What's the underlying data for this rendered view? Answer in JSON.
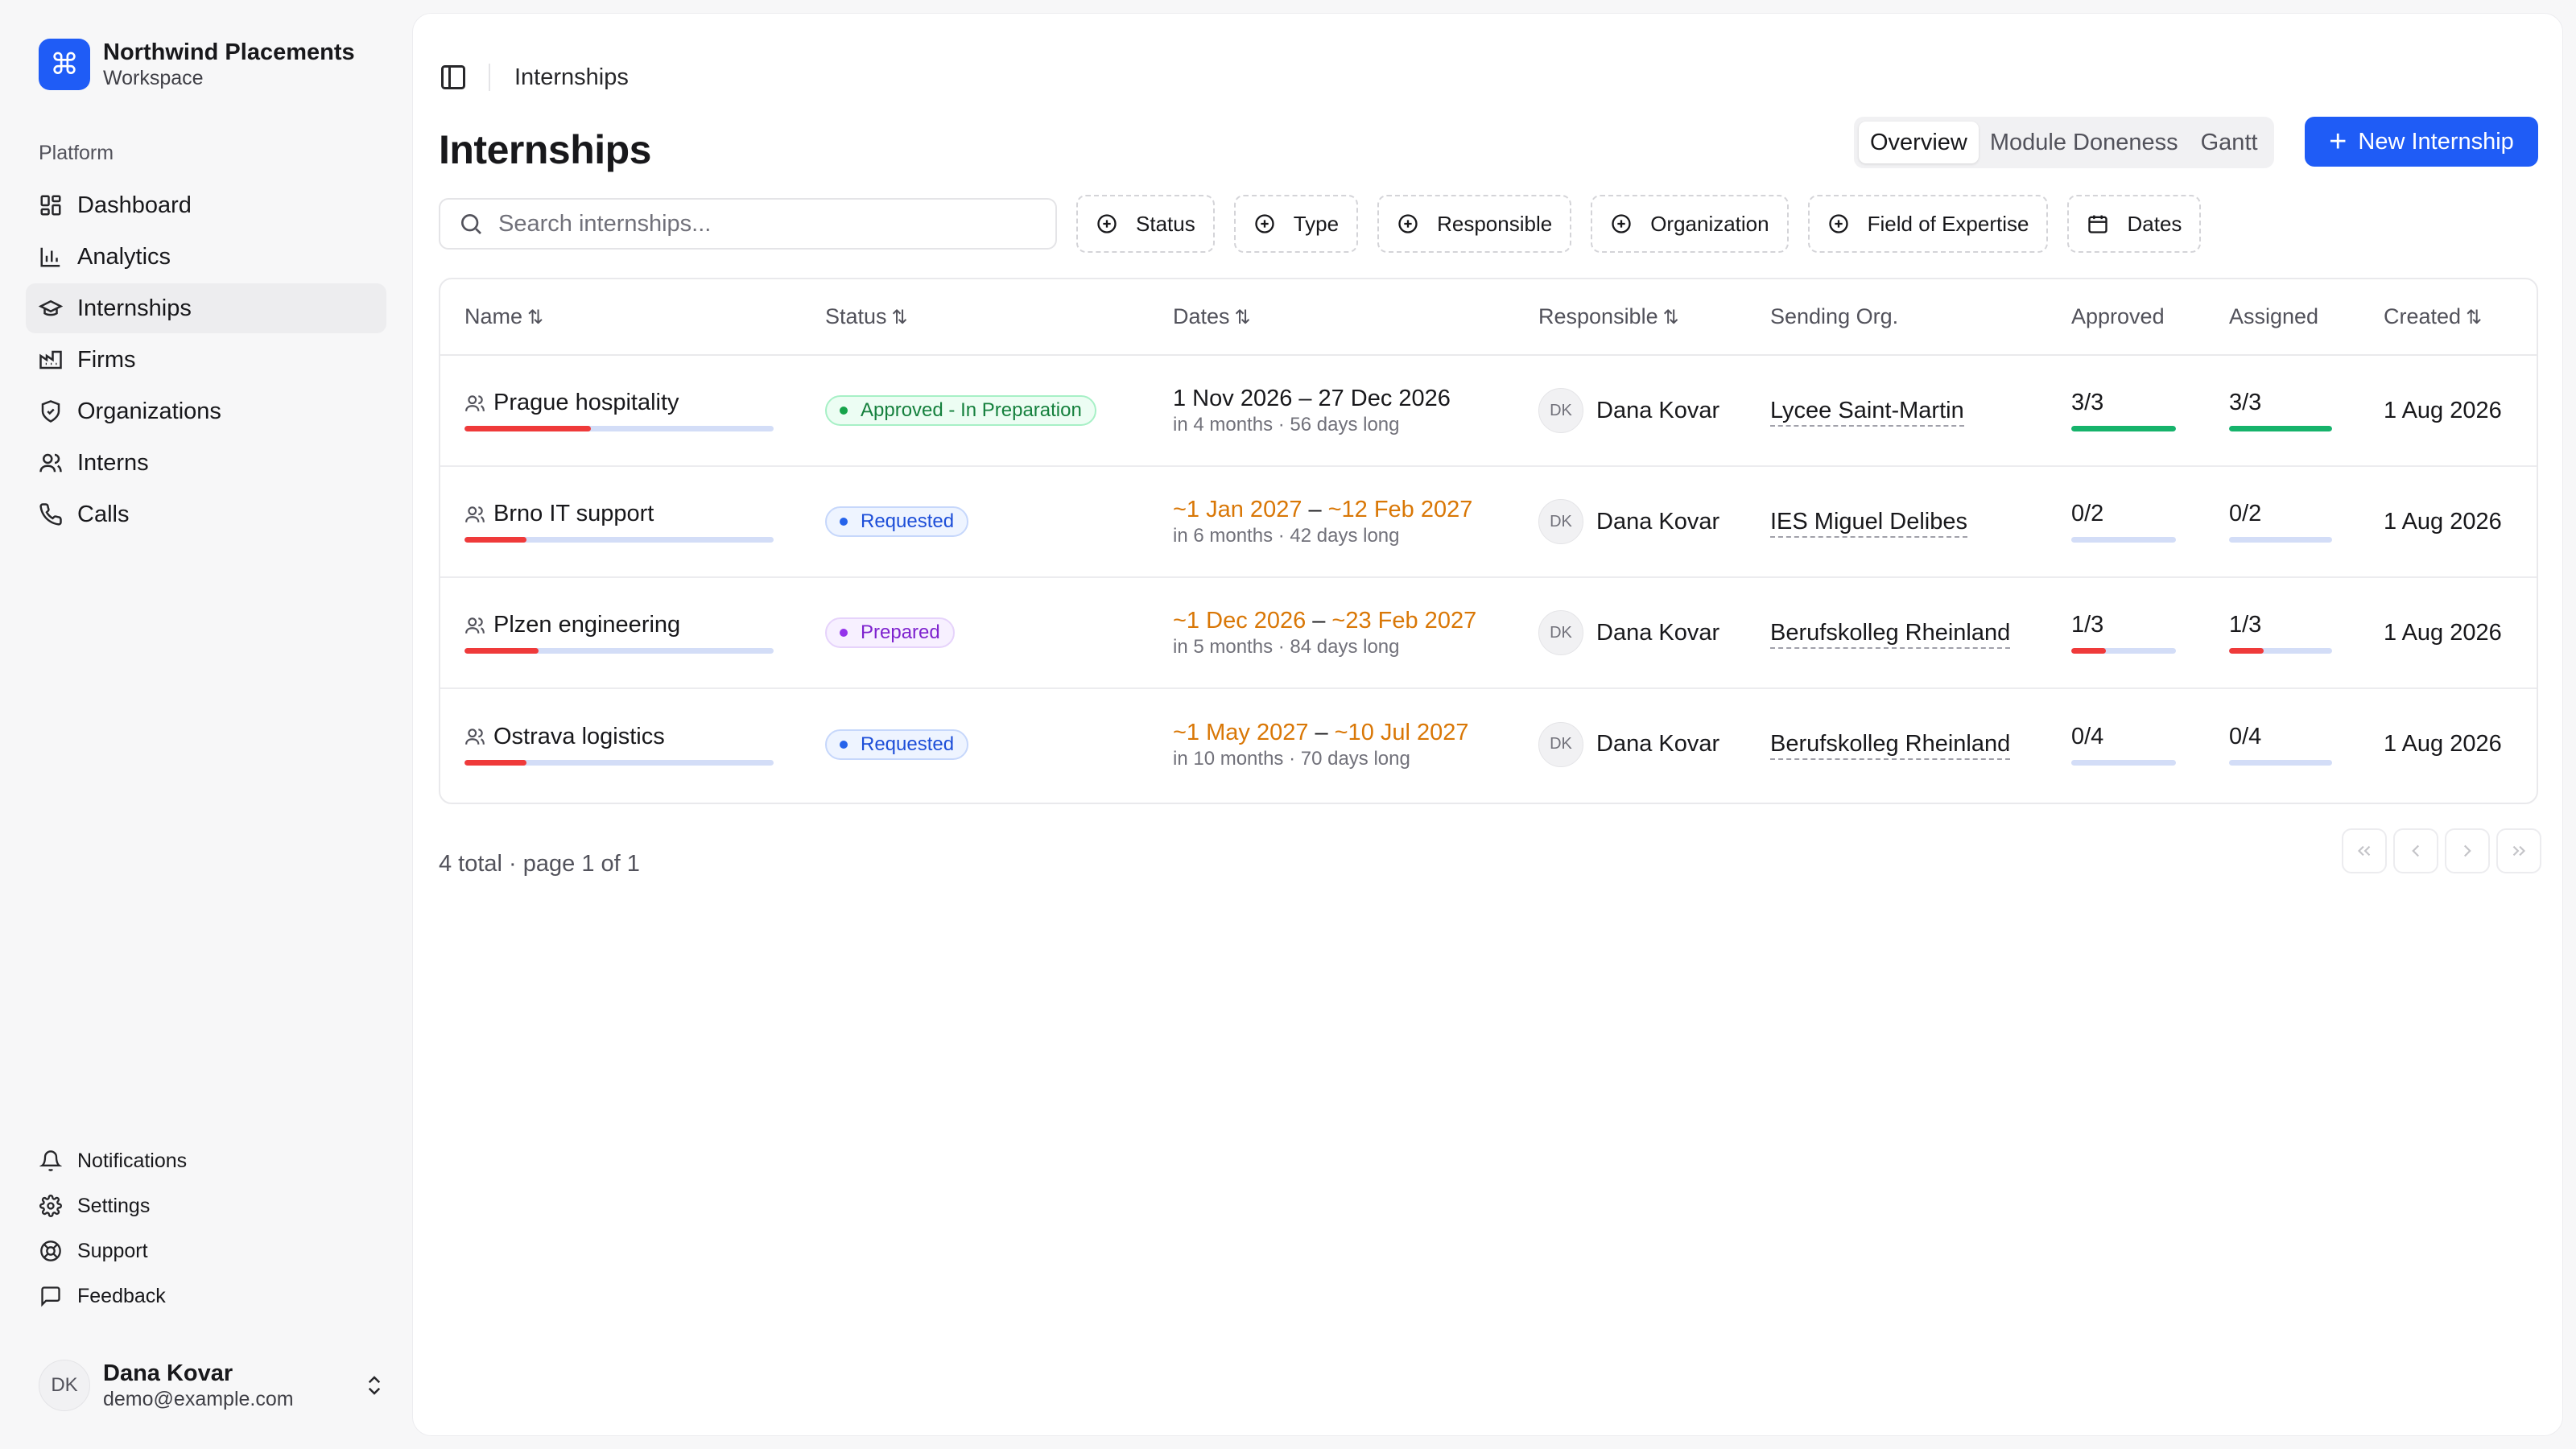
{
  "brand": {
    "name": "Northwind Placements",
    "subtitle": "Workspace",
    "logo_glyph": "⌘"
  },
  "sidebar": {
    "group_label": "Platform",
    "items": [
      {
        "label": "Dashboard",
        "icon": "dashboard-icon"
      },
      {
        "label": "Analytics",
        "icon": "bar-chart-icon"
      },
      {
        "label": "Internships",
        "icon": "graduation-cap-icon",
        "active": true
      },
      {
        "label": "Firms",
        "icon": "factory-icon"
      },
      {
        "label": "Organizations",
        "icon": "shield-icon"
      },
      {
        "label": "Interns",
        "icon": "users-icon"
      },
      {
        "label": "Calls",
        "icon": "phone-icon"
      }
    ],
    "bottom_items": [
      {
        "label": "Notifications",
        "icon": "bell-icon"
      },
      {
        "label": "Settings",
        "icon": "gear-icon"
      },
      {
        "label": "Support",
        "icon": "lifebuoy-icon"
      },
      {
        "label": "Feedback",
        "icon": "message-icon"
      }
    ],
    "user": {
      "initials": "DK",
      "name": "Dana Kovar",
      "email": "demo@example.com"
    }
  },
  "topbar": {
    "breadcrumb": "Internships"
  },
  "page": {
    "title": "Internships",
    "views": [
      "Overview",
      "Module Doneness",
      "Gantt"
    ],
    "active_view": "Overview",
    "new_button": "New Internship"
  },
  "filters": {
    "search_placeholder": "Search internships...",
    "chips": [
      "Status",
      "Type",
      "Responsible",
      "Organization",
      "Field of Expertise",
      "Dates"
    ]
  },
  "table": {
    "columns": [
      "Name",
      "Status",
      "Dates",
      "Responsible",
      "Sending Org.",
      "Approved",
      "Assigned",
      "Created"
    ],
    "rows": [
      {
        "name": "Prague hospitality",
        "progress": 0.41,
        "status": "Approved - In Preparation",
        "status_color": "green",
        "date_start": "1 Nov 2026",
        "date_end": "27 Dec 2026",
        "estimated": false,
        "date_sub": "in 4 months · 56 days long",
        "responsible_initials": "DK",
        "responsible": "Dana Kovar",
        "org": "Lycee Saint-Martin",
        "approved": "3/3",
        "approved_frac": 1.0,
        "assigned": "3/3",
        "assigned_frac": 1.0,
        "created": "1 Aug 2026"
      },
      {
        "name": "Brno IT support",
        "progress": 0.2,
        "status": "Requested",
        "status_color": "blue",
        "date_start": "~1 Jan 2027",
        "date_end": "~12 Feb 2027",
        "estimated": true,
        "date_sub": "in 6 months · 42 days long",
        "responsible_initials": "DK",
        "responsible": "Dana Kovar",
        "org": "IES Miguel Delibes",
        "approved": "0/2",
        "approved_frac": 0,
        "assigned": "0/2",
        "assigned_frac": 0,
        "created": "1 Aug 2026"
      },
      {
        "name": "Plzen engineering",
        "progress": 0.24,
        "status": "Prepared",
        "status_color": "purple",
        "date_start": "~1 Dec 2026",
        "date_end": "~23 Feb 2027",
        "estimated": true,
        "date_sub": "in 5 months · 84 days long",
        "responsible_initials": "DK",
        "responsible": "Dana Kovar",
        "org": "Berufskolleg Rheinland",
        "approved": "1/3",
        "approved_frac": 0.333,
        "assigned": "1/3",
        "assigned_frac": 0.333,
        "created": "1 Aug 2026"
      },
      {
        "name": "Ostrava logistics",
        "progress": 0.2,
        "status": "Requested",
        "status_color": "blue",
        "date_start": "~1 May 2027",
        "date_end": "~10 Jul 2027",
        "estimated": true,
        "date_sub": "in 10 months · 70 days long",
        "responsible_initials": "DK",
        "responsible": "Dana Kovar",
        "org": "Berufskolleg Rheinland",
        "approved": "0/4",
        "approved_frac": 0,
        "assigned": "0/4",
        "assigned_frac": 0,
        "created": "1 Aug 2026"
      }
    ]
  },
  "footer": {
    "summary": "4 total · page 1 of 1"
  },
  "colors": {
    "accent": "#1f5cf6",
    "danger": "#ef3a3a",
    "success": "#16b36b",
    "estimate": "#d97706"
  }
}
